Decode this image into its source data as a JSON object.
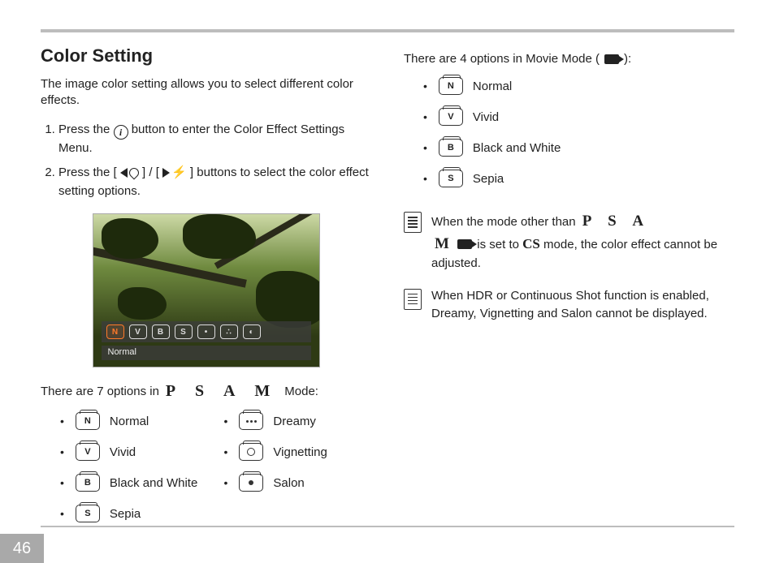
{
  "page_number": "46",
  "heading": "Color Setting",
  "intro": "The image color setting allows you to select different color effects.",
  "steps": {
    "s1_a": "Press the ",
    "s1_b": " button to enter the Color Effect Settings Menu.",
    "s2_a": "Press the [ ",
    "s2_b": " ] / [ ",
    "s2_c": " ] buttons to select the color effect setting options."
  },
  "info_button_label": "i",
  "screenshot": {
    "overlay_icons": [
      "N",
      "V",
      "B",
      "S",
      "•",
      "∴",
      "◐"
    ],
    "selected_label": "Normal"
  },
  "psam_intro_a": "There are 7 options in ",
  "psam_intro_b": " Mode:",
  "psam_letters": "P S A M",
  "psam_options_col1": [
    {
      "letter": "N",
      "label": "Normal"
    },
    {
      "letter": "V",
      "label": "Vivid"
    },
    {
      "letter": "B",
      "label": "Black and White"
    },
    {
      "letter": "S",
      "label": "Sepia"
    }
  ],
  "psam_options_col2": [
    {
      "kind": "dots",
      "label": "Dreamy"
    },
    {
      "kind": "ring",
      "label": "Vignetting"
    },
    {
      "kind": "dot",
      "label": "Salon"
    }
  ],
  "movie_intro_a": "There are 4 options in Movie Mode ( ",
  "movie_intro_b": " ):",
  "movie_options": [
    {
      "letter": "N",
      "label": "Normal"
    },
    {
      "letter": "V",
      "label": "Vivid"
    },
    {
      "letter": "B",
      "label": "Black and White"
    },
    {
      "letter": "S",
      "label": "Sepia"
    }
  ],
  "note1": {
    "a": "When the mode other than ",
    "letters1": "P S A",
    "letters2": "M",
    "b": " is set to ",
    "cs": "CS",
    "c": " mode, the color effect cannot be adjusted."
  },
  "note2": "When HDR or Continuous Shot function is enabled, Dreamy, Vignetting and Salon cannot be displayed."
}
